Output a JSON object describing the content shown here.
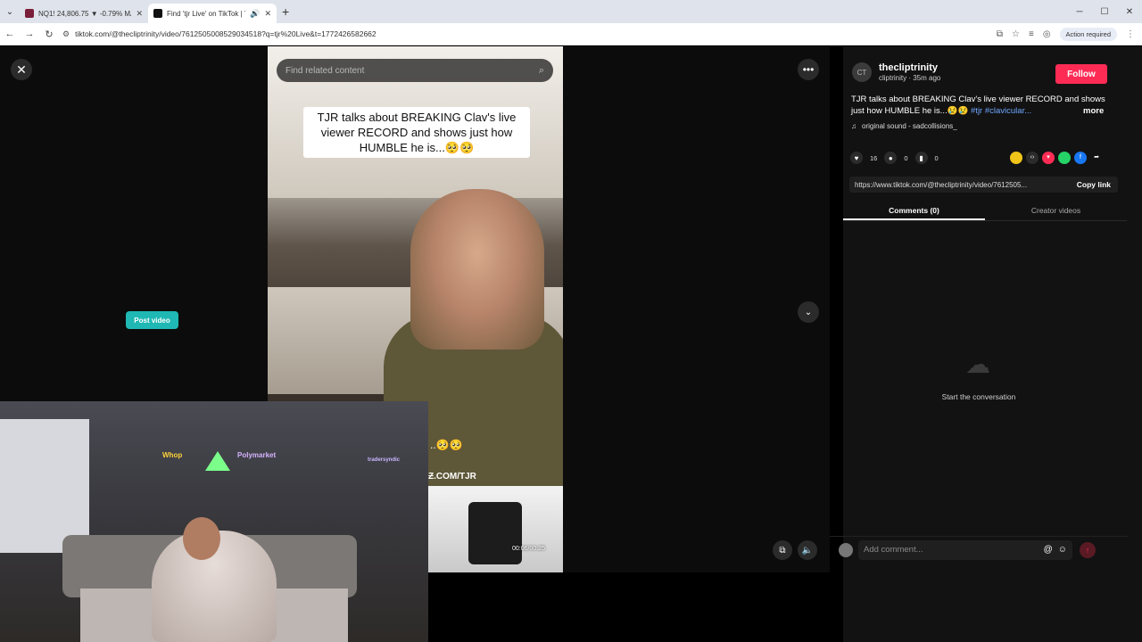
{
  "browser": {
    "tabs": [
      {
        "title": "NQ1! 24,806.75 ▼ -0.79% MA",
        "active": false
      },
      {
        "title": "Find 'tjr Live' on TikTok | Ti",
        "active": true
      }
    ],
    "url": "tiktok.com/@thecliptrinity/video/7612505008529034518?q=tjr%20Live&t=1772426582662",
    "action_required": "Action required"
  },
  "video": {
    "search_placeholder": "Find related content",
    "caption": "TJR talks about BREAKING Clav's live viewer RECORD and shows just how HUMBLE he is...🥺🥺",
    "emoji_strip": "..🥺🥺",
    "brand_label": "Ƶ.COM/TJR",
    "timecode": "00:06/00:25",
    "post_video": "Post video"
  },
  "webcam": {
    "sign_1": "Whop",
    "sign_2": "Polymarket",
    "sign_3": "tradersyndic"
  },
  "panel": {
    "author_name": "thecliptrinity",
    "author_meta": "cliptrinity · 35m ago",
    "follow": "Follow",
    "description": "TJR talks about BREAKING Clav's live viewer RECORD and shows just how HUMBLE he is...😢😢",
    "tags": "#tjr #clavicular...",
    "more": "more",
    "sound": "original sound - sadcollisions_",
    "likes": "16",
    "comments": "0",
    "saves": "0",
    "link_url": "https://www.tiktok.com/@thecliptrinity/video/7612505...",
    "copy_link": "Copy link",
    "tab_comments": "Comments (0)",
    "tab_creator": "Creator videos",
    "empty_text": "Start the conversation",
    "comment_placeholder": "Add comment..."
  }
}
